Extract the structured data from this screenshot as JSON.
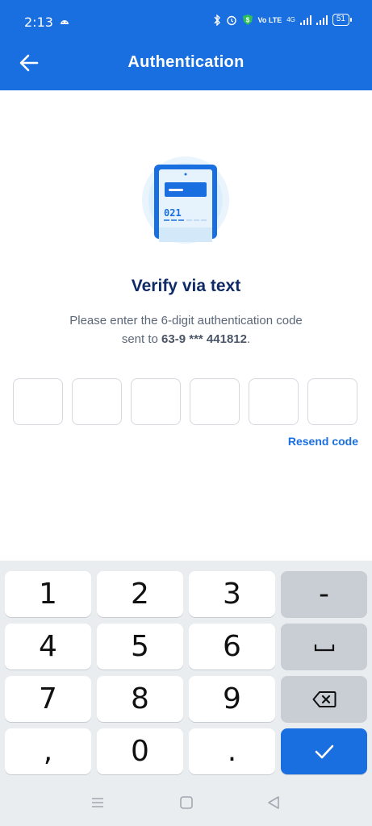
{
  "status_bar": {
    "time": "2:13",
    "network": "4G",
    "volte": "Vo LTE",
    "battery": "51"
  },
  "header": {
    "title": "Authentication",
    "background": "#1a6fe0"
  },
  "illustration": {
    "code_text": "021"
  },
  "main": {
    "heading": "Verify via text",
    "description_line1": "Please enter the 6-digit authentication code",
    "description_prefix": "sent to ",
    "phone": "63-9 *** 441812",
    "description_suffix": ".",
    "code_boxes": [
      "",
      "",
      "",
      "",
      "",
      ""
    ],
    "resend_label": "Resend code"
  },
  "keyboard": {
    "keys": [
      "1",
      "2",
      "3",
      "-",
      "4",
      "5",
      "6",
      "space",
      "7",
      "8",
      "9",
      "backspace",
      ",",
      "0",
      ".",
      "done"
    ],
    "accent": "#1a6fe0"
  },
  "nav_bar": {
    "icons": [
      "menu-icon",
      "home-square-icon",
      "back-triangle-icon"
    ]
  }
}
